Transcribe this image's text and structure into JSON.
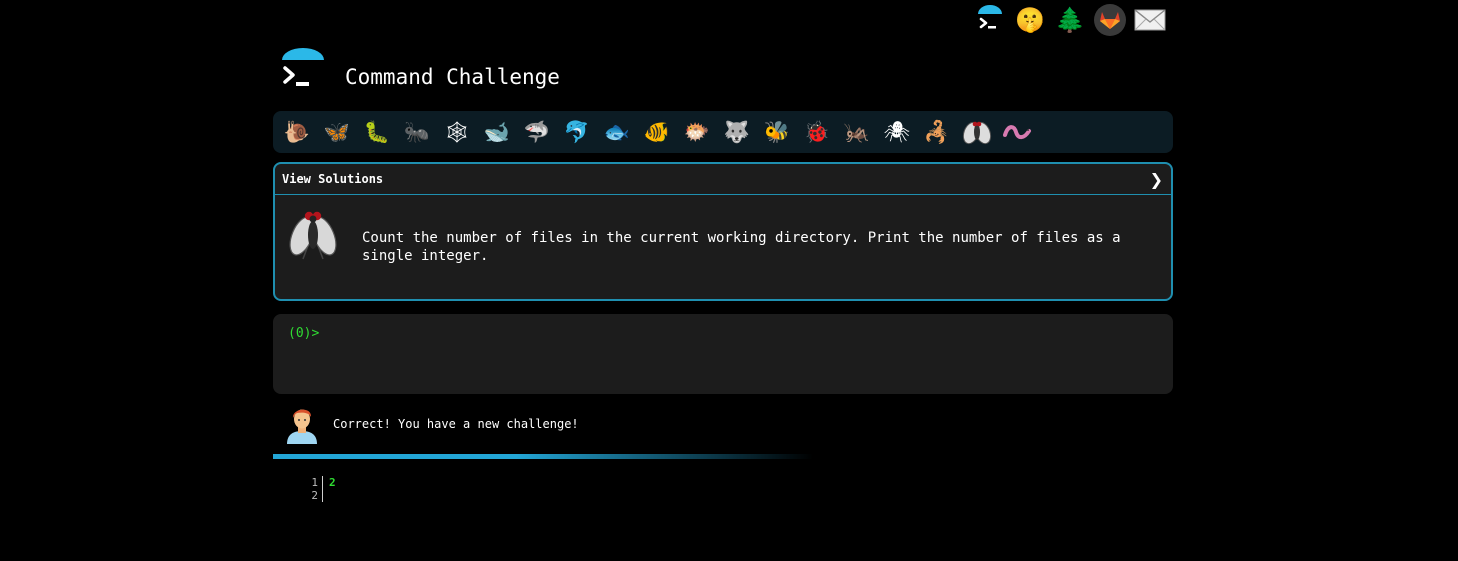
{
  "top_icons": [
    {
      "name": "terminal-logo-icon",
      "glyph": ""
    },
    {
      "name": "shushing-face-icon",
      "glyph": "🤫"
    },
    {
      "name": "tree-icon",
      "glyph": "🌲"
    },
    {
      "name": "gitlab-icon",
      "glyph": ""
    },
    {
      "name": "envelope-icon",
      "glyph": "✉"
    }
  ],
  "header": {
    "title": "Command Challenge"
  },
  "levels": [
    {
      "name": "snail-icon",
      "glyph": "🐌"
    },
    {
      "name": "butterfly-icon",
      "glyph": "🦋"
    },
    {
      "name": "caterpillar-icon",
      "glyph": "🐛"
    },
    {
      "name": "ant-icon",
      "glyph": "🐜"
    },
    {
      "name": "spider-web-icon",
      "glyph": "🕸"
    },
    {
      "name": "whale-icon",
      "glyph": "🐋"
    },
    {
      "name": "shark-icon",
      "glyph": "🦈"
    },
    {
      "name": "dolphin-icon",
      "glyph": "🐬"
    },
    {
      "name": "fish-icon",
      "glyph": "🐟"
    },
    {
      "name": "tropical-fish-icon",
      "glyph": "🐠"
    },
    {
      "name": "blowfish-icon",
      "glyph": "🐡"
    },
    {
      "name": "wolf-icon",
      "glyph": "🐺"
    },
    {
      "name": "bee-icon",
      "glyph": "🐝"
    },
    {
      "name": "ladybug-icon",
      "glyph": "🐞"
    },
    {
      "name": "cricket-icon",
      "glyph": "🦗"
    },
    {
      "name": "spider-icon",
      "glyph": "🕷"
    },
    {
      "name": "scorpion-icon",
      "glyph": "🦂"
    },
    {
      "name": "fly-icon",
      "glyph": "🪰"
    },
    {
      "name": "worm-icon",
      "glyph": "🪱"
    }
  ],
  "challenge": {
    "header_label": "View Solutions",
    "text": "Count the number of files in the current working directory. Print the number of files as a single integer."
  },
  "terminal": {
    "prompt": "(0)>"
  },
  "feedback": {
    "message": "Correct! You have a new challenge!"
  },
  "output": {
    "line_numbers": [
      "1",
      "2"
    ],
    "lines": [
      "2",
      ""
    ]
  },
  "colors": {
    "accent": "#1f8fb0",
    "prompt_green": "#2fdc32",
    "panel_bg": "#1c1c1c",
    "strip_bg": "#0c1c24"
  }
}
